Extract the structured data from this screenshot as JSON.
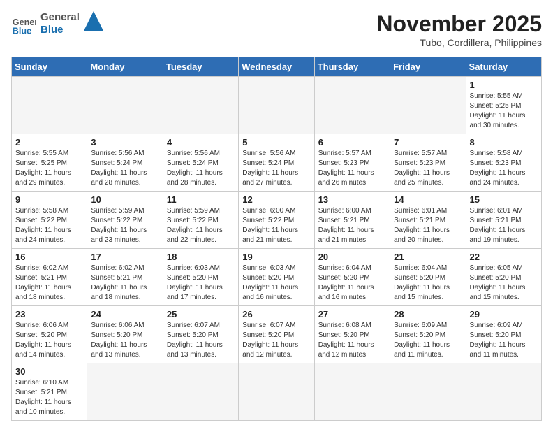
{
  "header": {
    "logo_general": "General",
    "logo_blue": "Blue",
    "month_title": "November 2025",
    "location": "Tubo, Cordillera, Philippines"
  },
  "weekdays": [
    "Sunday",
    "Monday",
    "Tuesday",
    "Wednesday",
    "Thursday",
    "Friday",
    "Saturday"
  ],
  "weeks": [
    [
      {
        "day": "",
        "info": ""
      },
      {
        "day": "",
        "info": ""
      },
      {
        "day": "",
        "info": ""
      },
      {
        "day": "",
        "info": ""
      },
      {
        "day": "",
        "info": ""
      },
      {
        "day": "",
        "info": ""
      },
      {
        "day": "1",
        "info": "Sunrise: 5:55 AM\nSunset: 5:25 PM\nDaylight: 11 hours\nand 30 minutes."
      }
    ],
    [
      {
        "day": "2",
        "info": "Sunrise: 5:55 AM\nSunset: 5:25 PM\nDaylight: 11 hours\nand 29 minutes."
      },
      {
        "day": "3",
        "info": "Sunrise: 5:56 AM\nSunset: 5:24 PM\nDaylight: 11 hours\nand 28 minutes."
      },
      {
        "day": "4",
        "info": "Sunrise: 5:56 AM\nSunset: 5:24 PM\nDaylight: 11 hours\nand 28 minutes."
      },
      {
        "day": "5",
        "info": "Sunrise: 5:56 AM\nSunset: 5:24 PM\nDaylight: 11 hours\nand 27 minutes."
      },
      {
        "day": "6",
        "info": "Sunrise: 5:57 AM\nSunset: 5:23 PM\nDaylight: 11 hours\nand 26 minutes."
      },
      {
        "day": "7",
        "info": "Sunrise: 5:57 AM\nSunset: 5:23 PM\nDaylight: 11 hours\nand 25 minutes."
      },
      {
        "day": "8",
        "info": "Sunrise: 5:58 AM\nSunset: 5:23 PM\nDaylight: 11 hours\nand 24 minutes."
      }
    ],
    [
      {
        "day": "9",
        "info": "Sunrise: 5:58 AM\nSunset: 5:22 PM\nDaylight: 11 hours\nand 24 minutes."
      },
      {
        "day": "10",
        "info": "Sunrise: 5:59 AM\nSunset: 5:22 PM\nDaylight: 11 hours\nand 23 minutes."
      },
      {
        "day": "11",
        "info": "Sunrise: 5:59 AM\nSunset: 5:22 PM\nDaylight: 11 hours\nand 22 minutes."
      },
      {
        "day": "12",
        "info": "Sunrise: 6:00 AM\nSunset: 5:22 PM\nDaylight: 11 hours\nand 21 minutes."
      },
      {
        "day": "13",
        "info": "Sunrise: 6:00 AM\nSunset: 5:21 PM\nDaylight: 11 hours\nand 21 minutes."
      },
      {
        "day": "14",
        "info": "Sunrise: 6:01 AM\nSunset: 5:21 PM\nDaylight: 11 hours\nand 20 minutes."
      },
      {
        "day": "15",
        "info": "Sunrise: 6:01 AM\nSunset: 5:21 PM\nDaylight: 11 hours\nand 19 minutes."
      }
    ],
    [
      {
        "day": "16",
        "info": "Sunrise: 6:02 AM\nSunset: 5:21 PM\nDaylight: 11 hours\nand 18 minutes."
      },
      {
        "day": "17",
        "info": "Sunrise: 6:02 AM\nSunset: 5:21 PM\nDaylight: 11 hours\nand 18 minutes."
      },
      {
        "day": "18",
        "info": "Sunrise: 6:03 AM\nSunset: 5:20 PM\nDaylight: 11 hours\nand 17 minutes."
      },
      {
        "day": "19",
        "info": "Sunrise: 6:03 AM\nSunset: 5:20 PM\nDaylight: 11 hours\nand 16 minutes."
      },
      {
        "day": "20",
        "info": "Sunrise: 6:04 AM\nSunset: 5:20 PM\nDaylight: 11 hours\nand 16 minutes."
      },
      {
        "day": "21",
        "info": "Sunrise: 6:04 AM\nSunset: 5:20 PM\nDaylight: 11 hours\nand 15 minutes."
      },
      {
        "day": "22",
        "info": "Sunrise: 6:05 AM\nSunset: 5:20 PM\nDaylight: 11 hours\nand 15 minutes."
      }
    ],
    [
      {
        "day": "23",
        "info": "Sunrise: 6:06 AM\nSunset: 5:20 PM\nDaylight: 11 hours\nand 14 minutes."
      },
      {
        "day": "24",
        "info": "Sunrise: 6:06 AM\nSunset: 5:20 PM\nDaylight: 11 hours\nand 13 minutes."
      },
      {
        "day": "25",
        "info": "Sunrise: 6:07 AM\nSunset: 5:20 PM\nDaylight: 11 hours\nand 13 minutes."
      },
      {
        "day": "26",
        "info": "Sunrise: 6:07 AM\nSunset: 5:20 PM\nDaylight: 11 hours\nand 12 minutes."
      },
      {
        "day": "27",
        "info": "Sunrise: 6:08 AM\nSunset: 5:20 PM\nDaylight: 11 hours\nand 12 minutes."
      },
      {
        "day": "28",
        "info": "Sunrise: 6:09 AM\nSunset: 5:20 PM\nDaylight: 11 hours\nand 11 minutes."
      },
      {
        "day": "29",
        "info": "Sunrise: 6:09 AM\nSunset: 5:20 PM\nDaylight: 11 hours\nand 11 minutes."
      }
    ],
    [
      {
        "day": "30",
        "info": "Sunrise: 6:10 AM\nSunset: 5:21 PM\nDaylight: 11 hours\nand 10 minutes."
      },
      {
        "day": "",
        "info": ""
      },
      {
        "day": "",
        "info": ""
      },
      {
        "day": "",
        "info": ""
      },
      {
        "day": "",
        "info": ""
      },
      {
        "day": "",
        "info": ""
      },
      {
        "day": "",
        "info": ""
      }
    ]
  ]
}
